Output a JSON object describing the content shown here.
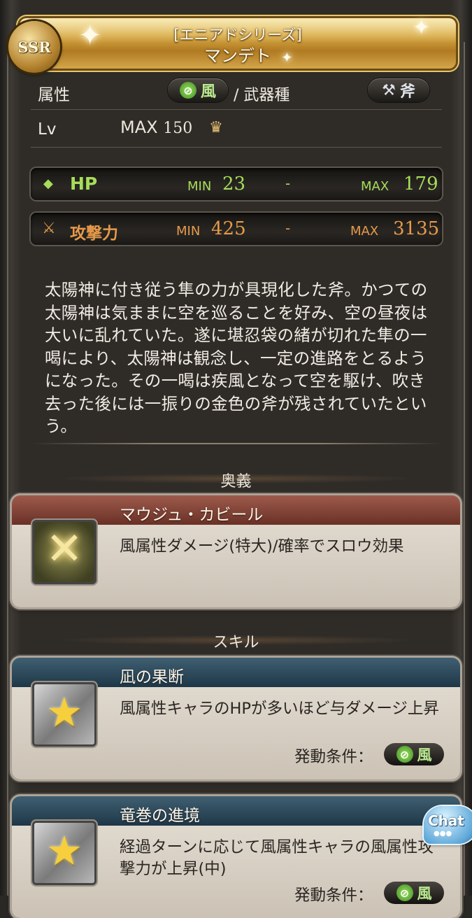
{
  "header": {
    "rarity": "SSR",
    "series": "[エニアドシリーズ]",
    "weapon_name": "マンデト"
  },
  "attributes": {
    "element_label": "属性",
    "element_value": "風",
    "separator": "/ 武器種",
    "weapon_type": "斧",
    "level_label": "Lv",
    "level_prefix": "MAX",
    "level_value": "150"
  },
  "stats": {
    "hp": {
      "label": "HP",
      "min_label": "MIN",
      "min": "23",
      "dash": "-",
      "max_label": "MAX",
      "max": "179"
    },
    "atk": {
      "label": "攻撃力",
      "min_label": "MIN",
      "min": "425",
      "dash": "-",
      "max_label": "MAX",
      "max": "3135"
    }
  },
  "description": "太陽神に付き従う隼の力が具現化した斧。かつての太陽神は気ままに空を巡ることを好み、空の昼夜は大いに乱れていた。遂に堪忍袋の緒が切れた隼の一喝により、太陽神は観念し、一定の進路をとるようになった。その一喝は疾風となって空を駆け、吹き去った後には一振りの金色の斧が残されていたという。",
  "ougi": {
    "section_title": "奥義",
    "name": "マウジュ・カビール",
    "effect": "風属性ダメージ(特大)/確率でスロウ効果"
  },
  "skills": {
    "section_title": "スキル",
    "items": [
      {
        "name": "凪の果断",
        "effect": "風属性キャラのHPが多いほど与ダメージ上昇",
        "condition_label": "発動条件：",
        "condition_value": "風"
      },
      {
        "name": "竜巻の進境",
        "effect": "経過ターンに応じて風属性キャラの風属性攻撃力が上昇(中)",
        "condition_label": "発動条件：",
        "condition_value": "風"
      }
    ]
  },
  "chat": {
    "label": "Chat"
  },
  "colors": {
    "hp": "#a7dd5a",
    "atk": "#e69a4a",
    "wind": "#b9e98e",
    "gold": "#d7a842"
  }
}
